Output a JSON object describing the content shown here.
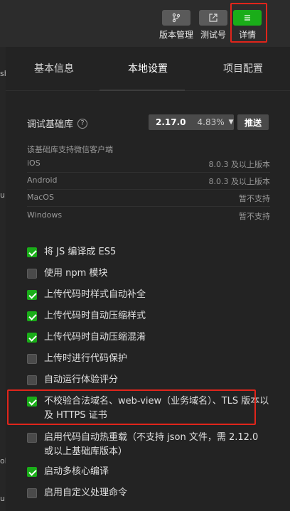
{
  "toolbar": {
    "version_mgmt": "版本管理",
    "test_account": "测试号",
    "details": "详情",
    "icons": [
      "branch-icon",
      "share-external-icon",
      "menu-lines-icon"
    ],
    "accent_color": "#1aad19",
    "highlight_color": "#e0251b"
  },
  "left_fragments": [
    "sh",
    "u",
    "ok",
    "u"
  ],
  "tabs": [
    {
      "label": "基本信息",
      "active": false
    },
    {
      "label": "本地设置",
      "active": true
    },
    {
      "label": "项目配置",
      "active": false
    }
  ],
  "library": {
    "label": "调试基础库",
    "version": "2.17.0",
    "percent": "4.83%",
    "push_label": "推送"
  },
  "support": {
    "note": "该基础库支持微信客户端",
    "rows": [
      {
        "platform": "iOS",
        "status": "8.0.3 及以上版本"
      },
      {
        "platform": "Android",
        "status": "8.0.3 及以上版本"
      },
      {
        "platform": "MacOS",
        "status": "暂不支持"
      },
      {
        "platform": "Windows",
        "status": "暂不支持"
      }
    ]
  },
  "options": [
    {
      "label": "将 JS 编译成 ES5",
      "checked": true
    },
    {
      "label": "使用 npm 模块",
      "checked": false
    },
    {
      "label": "上传代码时样式自动补全",
      "checked": true
    },
    {
      "label": "上传代码时自动压缩样式",
      "checked": true
    },
    {
      "label": "上传代码时自动压缩混淆",
      "checked": true
    },
    {
      "label": "上传时进行代码保护",
      "checked": false
    },
    {
      "label": "自动运行体验评分",
      "checked": false
    },
    {
      "label": "不校验合法域名、web-view（业务域名）、TLS 版本以及 HTTPS 证书",
      "checked": true,
      "highlighted": true
    },
    {
      "label": "启用代码自动热重载（不支持 json 文件，需 2.12.0 或以上基础库版本）",
      "checked": false
    },
    {
      "label": "启动多核心编译",
      "checked": true
    },
    {
      "label": "启用自定义处理命令",
      "checked": false
    }
  ]
}
